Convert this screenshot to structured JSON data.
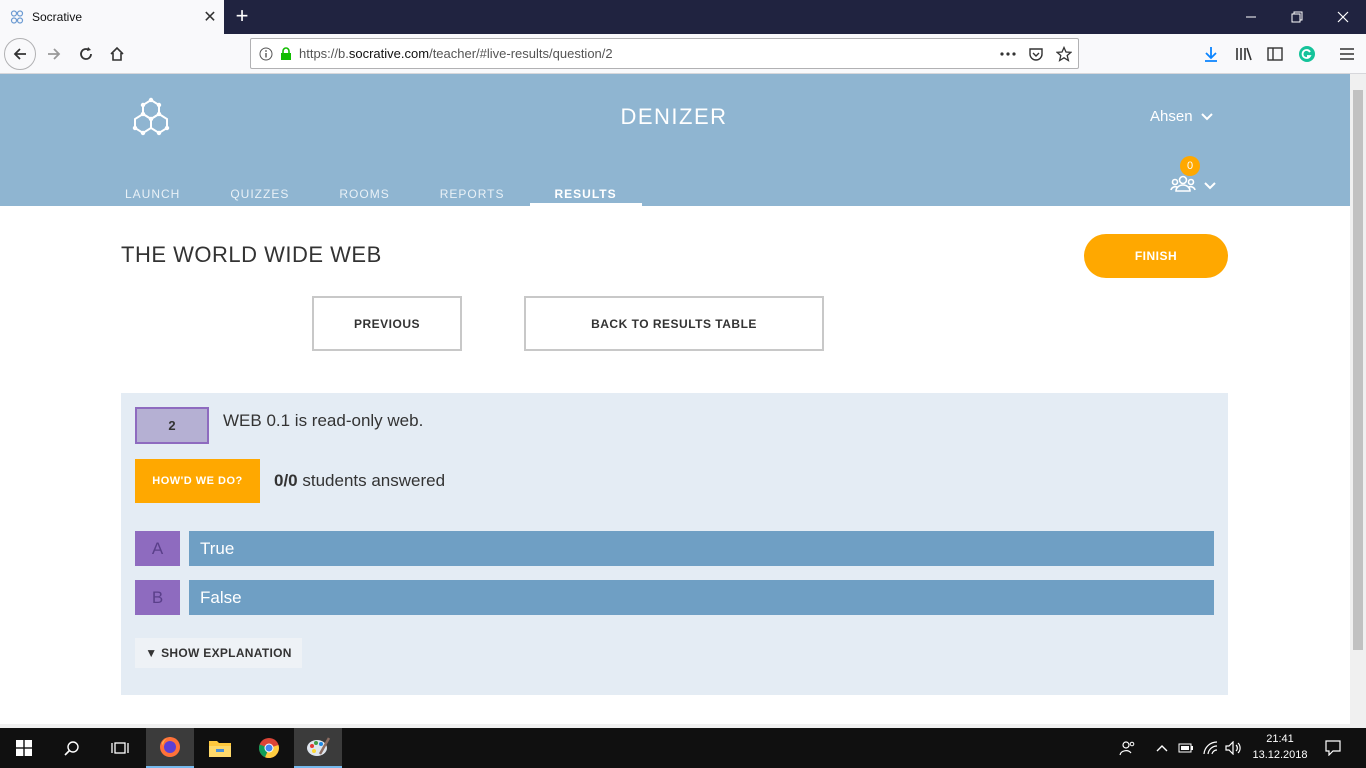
{
  "browser": {
    "tab_title": "Socrative",
    "url_prefix": "https://b.",
    "url_host": "socrative.com",
    "url_path": "/teacher/#live-results/question/2",
    "new_tab_symbol": "+"
  },
  "header": {
    "class_name": "DENIZER",
    "user_name": "Ahsen",
    "student_count": "0",
    "nav_tabs": [
      "LAUNCH",
      "QUIZZES",
      "ROOMS",
      "REPORTS",
      "RESULTS"
    ],
    "active_tab": "RESULTS"
  },
  "main": {
    "quiz_title": "THE WORLD WIDE WEB",
    "finish_label": "FINISH",
    "previous_label": "PREVIOUS",
    "back_label": "BACK TO RESULTS TABLE"
  },
  "question": {
    "number": "2",
    "text": "WEB 0.1 is read-only web.",
    "howd_label": "HOW'D WE DO?",
    "answered_count": "0/0",
    "answered_suffix": " students answered",
    "answers": [
      {
        "letter": "A",
        "text": "True"
      },
      {
        "letter": "B",
        "text": "False"
      }
    ],
    "explanation_label": "▼ SHOW EXPLANATION"
  },
  "taskbar": {
    "time": "21:41",
    "date": "13.12.2018"
  },
  "colors": {
    "header_bg": "#8fb5d1",
    "accent_orange": "#ffa800",
    "answer_bar": "#6f9fc4",
    "answer_letter": "#8e6bbf",
    "panel_bg": "#e4ecf4"
  }
}
